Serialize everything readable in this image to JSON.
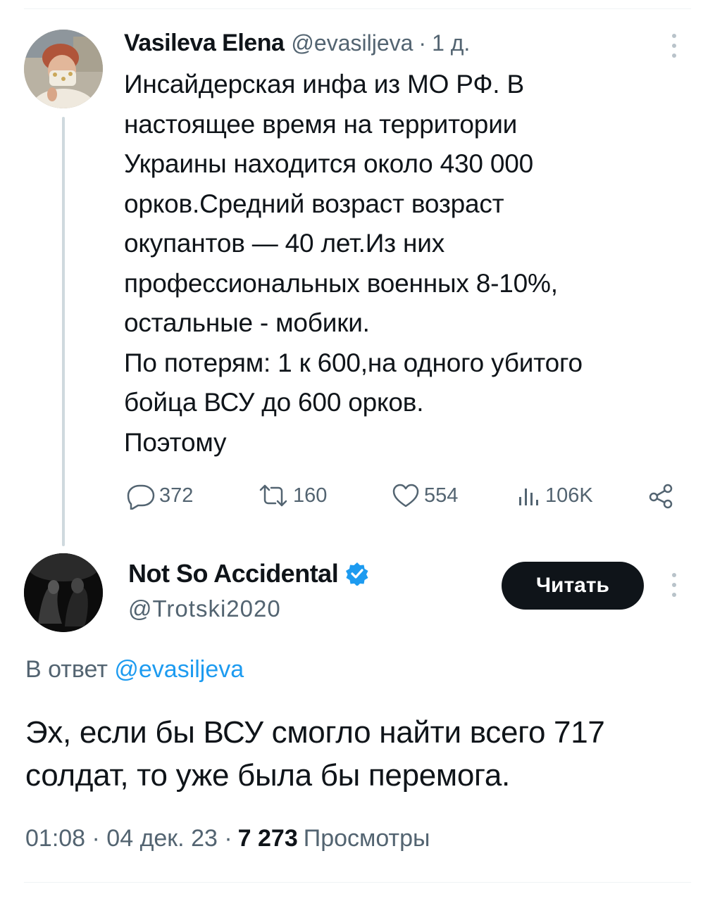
{
  "tweet1": {
    "author_name": "Vasileva Elena",
    "handle": "@evasiljeva",
    "separator": "·",
    "time": "1 д.",
    "text": "Инсайдерская инфа из МО РФ. В\nнастоящее время на территории\nУкраины находится около 430 000\nорков.Средний возраст возраст\nокупантов — 40 лет.Из них\nпрофессиональных военных 8-10%,\nостальные - мобики.\nПо потерям: 1 к 600,на одного убитого\nбойца ВСУ до 600 орков.\nПоэтому",
    "stats": {
      "replies": "372",
      "retweets": "160",
      "likes": "554",
      "views": "106K"
    }
  },
  "tweet2": {
    "author_name": "Not So Accidental",
    "handle": "@Trotski2020",
    "follow_label": "Читать",
    "reply_prefix": "В ответ",
    "reply_handle": "@evasiljeva",
    "text": "Эх, если бы ВСУ смогло найти всего 717 солдат, то уже была бы перемога.",
    "time": "01:08 · 04 дек. 23 ·",
    "views_count": "7 273",
    "views_label": "Просмотры"
  },
  "icons": {
    "reply": "reply-icon",
    "retweet": "retweet-icon",
    "like": "like-icon",
    "views": "views-icon",
    "share": "share-icon",
    "verified": "verified-badge-icon",
    "more": "more-icon"
  },
  "colors": {
    "text": "#0f1419",
    "muted": "#536471",
    "link": "#1d9bf0",
    "button_bg": "#0f1419",
    "thread_line": "#cfd9de"
  }
}
